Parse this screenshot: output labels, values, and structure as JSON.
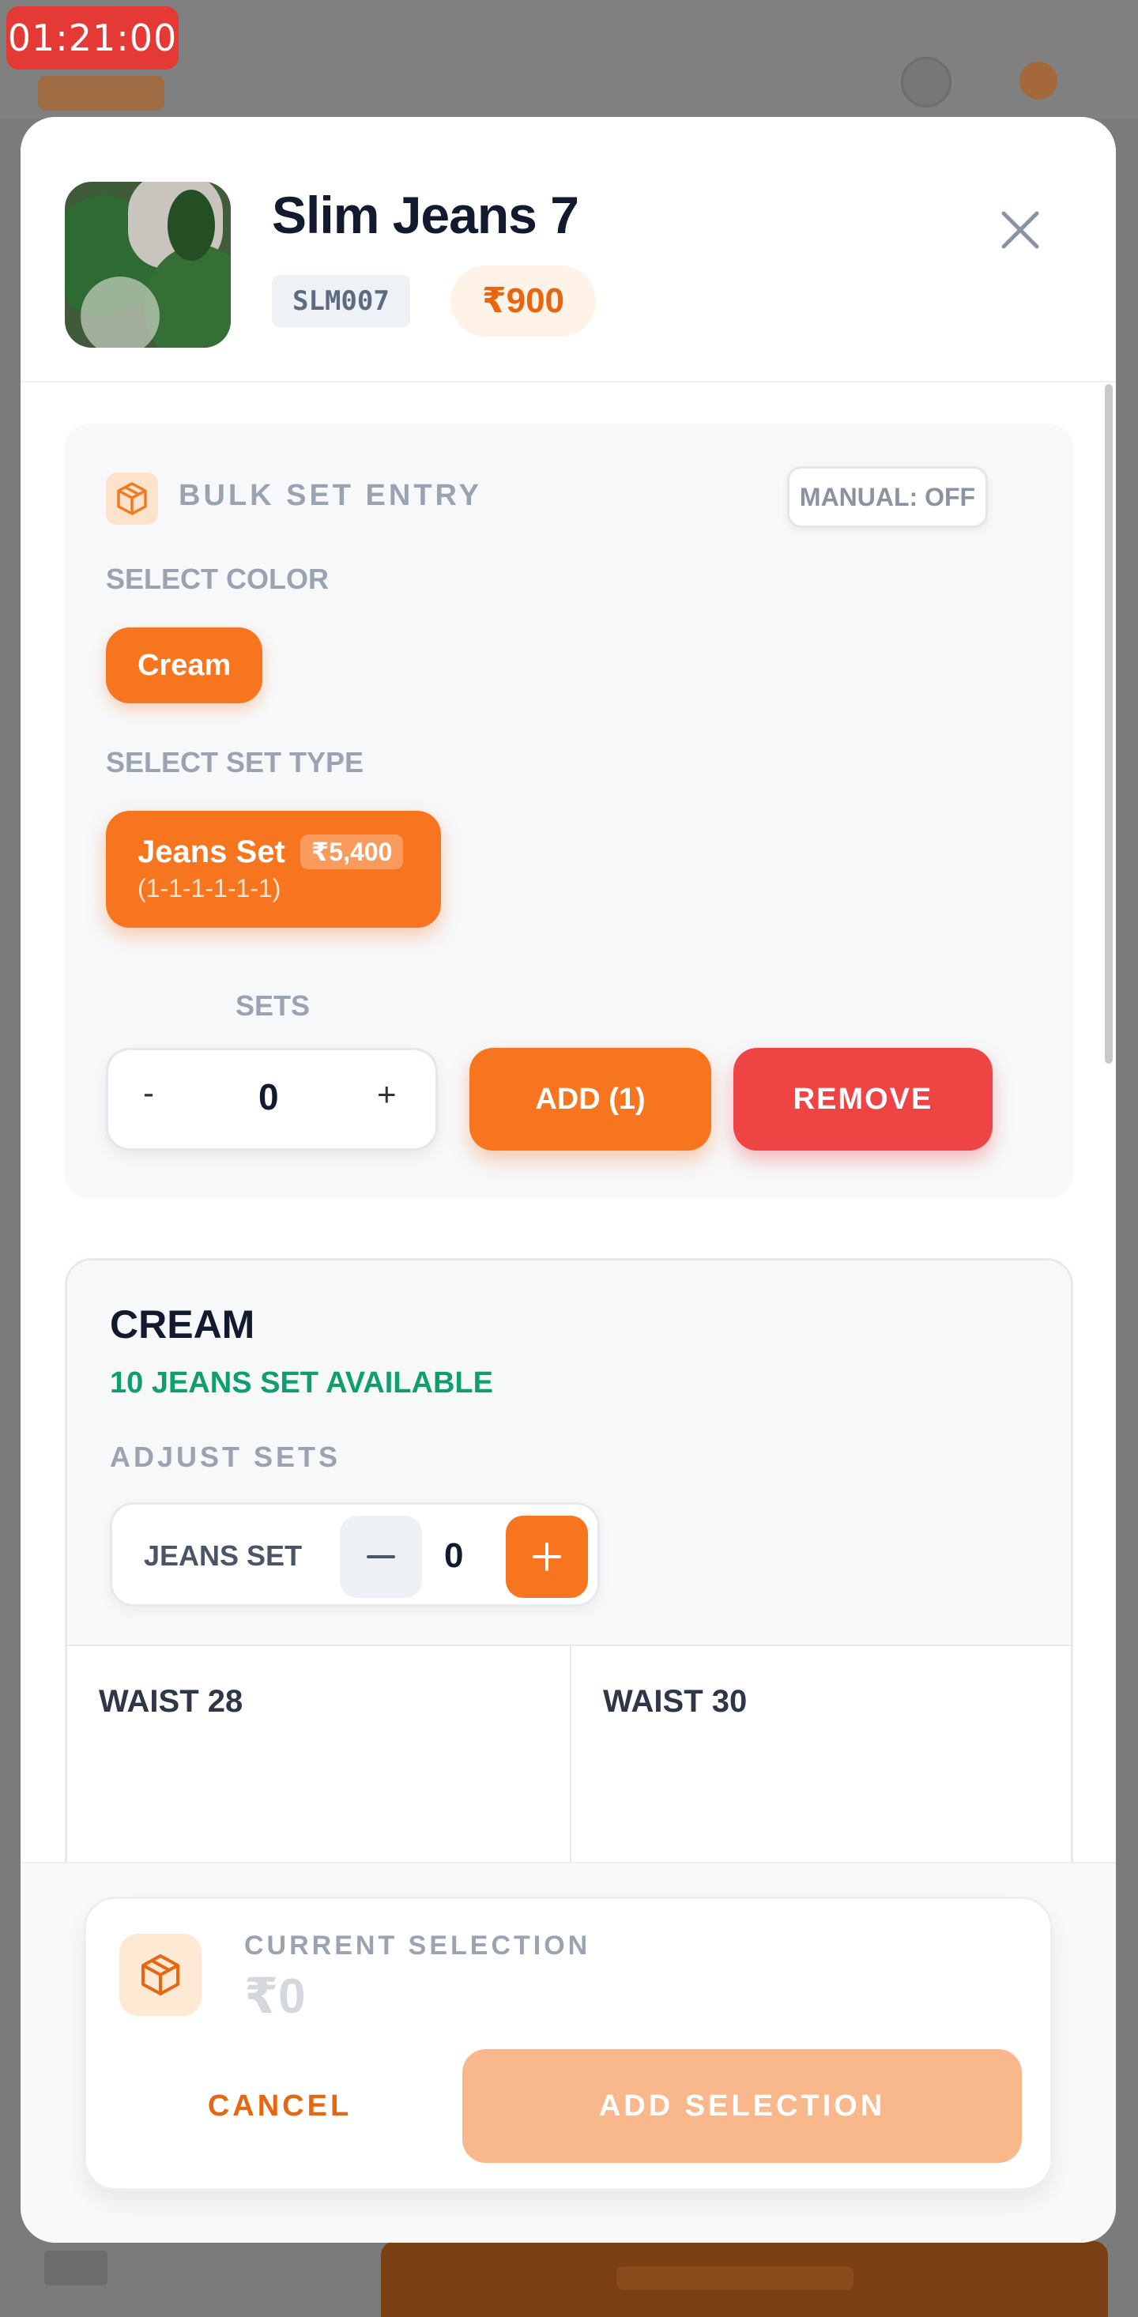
{
  "timer": "01:21:00",
  "product": {
    "title": "Slim Jeans 7",
    "sku": "SLM007",
    "price": "₹900"
  },
  "bulk": {
    "title": "BULK SET ENTRY",
    "manual_toggle": "MANUAL: OFF",
    "select_color_label": "SELECT COLOR",
    "colors": [
      "Cream"
    ],
    "select_set_type_label": "SELECT SET TYPE",
    "set_type": {
      "name": "Jeans Set",
      "price": "₹5,400",
      "pattern": "(1-1-1-1-1-1)"
    },
    "sets_label": "SETS",
    "stepper": {
      "minus": "-",
      "value": "0",
      "plus": "+"
    },
    "add_label": "ADD (1)",
    "remove_label": "REMOVE"
  },
  "color_section": {
    "title": "CREAM",
    "availability": "10 JEANS SET AVAILABLE",
    "adjust_label": "ADJUST SETS",
    "adjuster": {
      "label": "JEANS SET",
      "value": "0"
    },
    "waists": [
      "WAIST 28",
      "WAIST 30"
    ]
  },
  "footer": {
    "current_selection_label": "CURRENT SELECTION",
    "current_selection_value": "₹0",
    "cancel_label": "CANCEL",
    "add_selection_label": "ADD SELECTION"
  },
  "colors": {
    "accent": "#f7751f",
    "danger": "#ef4444",
    "success": "#109e6b"
  }
}
